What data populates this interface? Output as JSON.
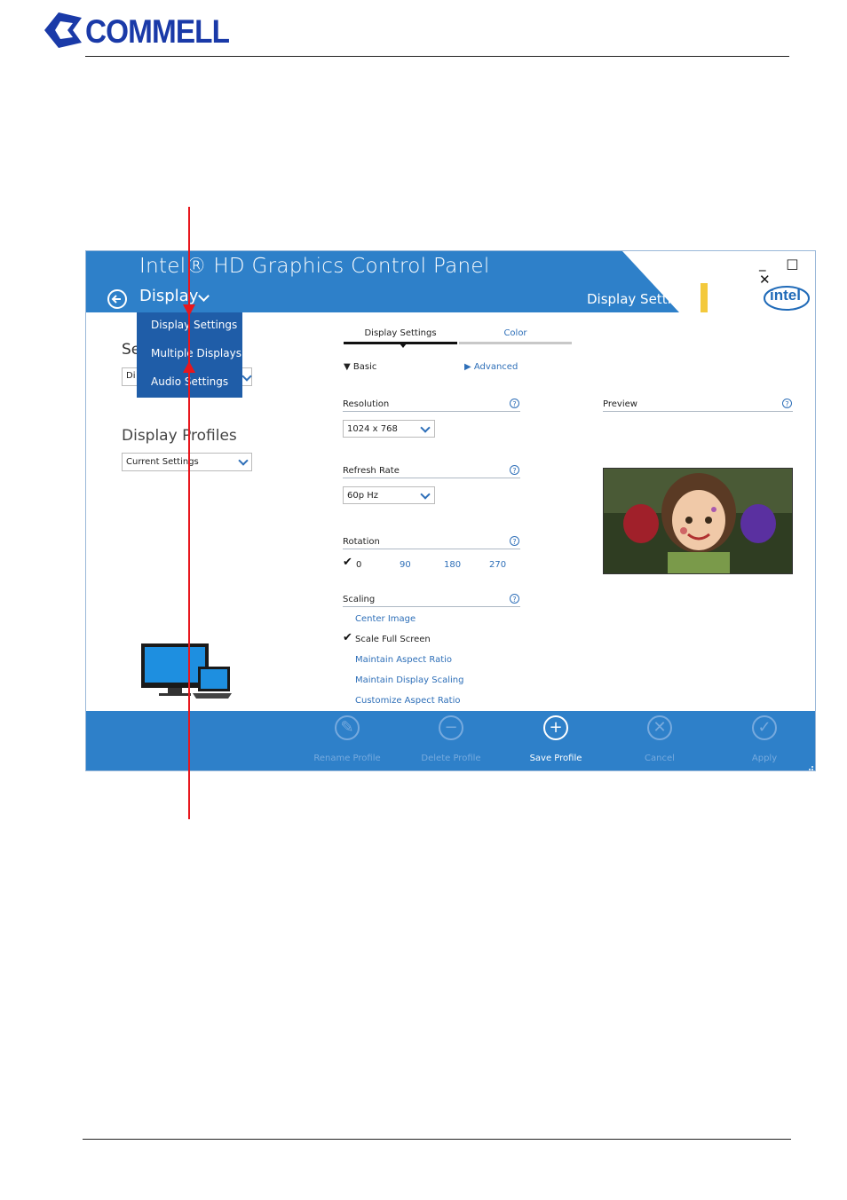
{
  "brand": {
    "logo_text": "COMMELL"
  },
  "window": {
    "title": "Intel® HD Graphics Control Panel",
    "nav_label": "Display",
    "section_title": "Display Settings",
    "controls": "_ □ ✕",
    "intel_logo_text": "intel"
  },
  "menu": {
    "items": [
      {
        "label": "Display Settings"
      },
      {
        "label": "Multiple Displays"
      },
      {
        "label": "Audio Settings"
      }
    ]
  },
  "left_panel": {
    "select_label_partial": "Se",
    "select_value_partial": "Di",
    "profiles_heading": "Display Profiles",
    "profile_value": "Current Settings"
  },
  "tabs": [
    {
      "label": "Display Settings",
      "active": true
    },
    {
      "label": "Color",
      "active": false
    }
  ],
  "modes": {
    "basic": "Basic",
    "advanced": "Advanced"
  },
  "resolution": {
    "label": "Resolution",
    "value": "1024 x 768"
  },
  "refresh": {
    "label": "Refresh Rate",
    "value": "60p Hz"
  },
  "rotation": {
    "label": "Rotation",
    "options": [
      "0",
      "90",
      "180",
      "270"
    ],
    "selected": "0"
  },
  "scaling": {
    "label": "Scaling",
    "options": [
      "Center Image",
      "Scale Full Screen",
      "Maintain Aspect Ratio",
      "Maintain Display Scaling",
      "Customize Aspect Ratio"
    ],
    "selected": "Scale Full Screen"
  },
  "preview": {
    "label": "Preview"
  },
  "help_glyph": "?",
  "bottom_bar": {
    "rename": "Rename Profile",
    "delete": "Delete Profile",
    "save": "Save Profile",
    "cancel": "Cancel",
    "apply": "Apply"
  },
  "colors": {
    "accent": "#2e80c9",
    "menu": "#1f5da8",
    "link": "#2e6fb8",
    "annotation": "#e8161d"
  }
}
